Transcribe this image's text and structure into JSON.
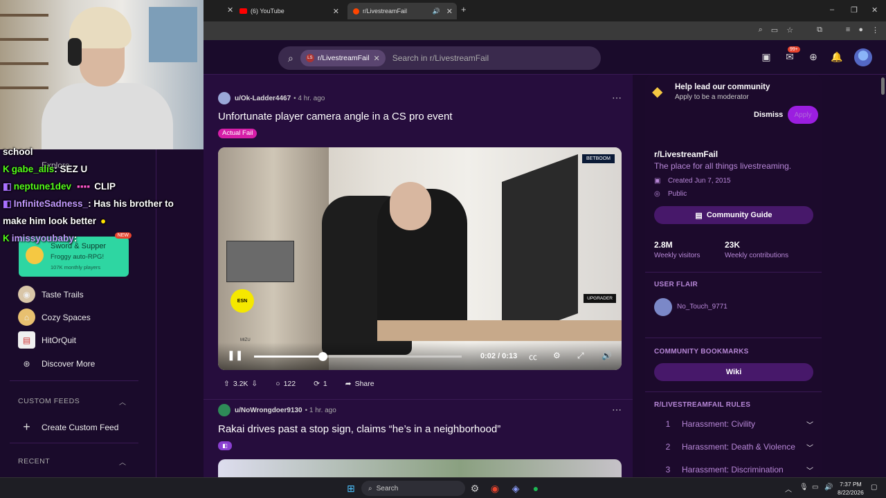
{
  "browser": {
    "tabs": [
      {
        "label": "(6) YouTube",
        "color": "#ff0000"
      },
      {
        "label": "r/LivestreamFail",
        "color": "#ff4500"
      }
    ],
    "new_tab": "+",
    "window_controls": [
      "–",
      "❐",
      "✕"
    ]
  },
  "reddit_header": {
    "search_chip": "r/LivestreamFail",
    "search_placeholder": "Search in r/LivestreamFail",
    "notification_count": "99+"
  },
  "chat": [
    {
      "platform": "",
      "user": "school",
      "message": ""
    },
    {
      "platform": "kick",
      "user": "gabe_alis",
      "message": ": SEZ U"
    },
    {
      "platform": "twitch",
      "user": "neptune1dev",
      "message": "CLIP"
    },
    {
      "platform": "twitch",
      "user": "InfiniteSadness_",
      "message": ": Has his brother to"
    },
    {
      "platform": "",
      "user": "",
      "message": "make him look better"
    },
    {
      "platform": "kick",
      "user": "imissyoubaby",
      "message": ":"
    }
  ],
  "left_sidebar": {
    "explore": "Explore",
    "promo": {
      "title": "Sword & Supper",
      "subtitle": "Froggy auto-RPG!",
      "meta": "107K monthly players",
      "badge": "NEW"
    },
    "items": [
      {
        "label": "Taste Trails",
        "icon": "taste-trails-icon"
      },
      {
        "label": "Cozy Spaces",
        "icon": "cozy-spaces-icon"
      },
      {
        "label": "HitOrQuit",
        "icon": "hitorquit-icon"
      },
      {
        "label": "Discover More",
        "icon": "gamepad-icon"
      }
    ],
    "custom_feeds_header": "CUSTOM FEEDS",
    "create_custom_feed": "Create Custom Feed",
    "recent_header": "RECENT"
  },
  "posts": [
    {
      "user": "u/Ok-Ladder4467",
      "time": "• 4 hr. ago",
      "title": "Unfortunate player camera angle in a CS pro event",
      "flair": "Actual Fail",
      "video": {
        "time": "0:02 / 0:13",
        "progress": 0.15,
        "sponsor_top": "BETBOOM",
        "sponsor_bottom": "UPGRADER",
        "watermark": "MIZU",
        "logo": "ESN"
      },
      "upvotes": "3.2K",
      "comments": "122",
      "crossposts": "1",
      "share": "Share"
    },
    {
      "user": "u/NoWrongdoer9130",
      "time": "• 1 hr. ago",
      "title": "Rakai drives past a stop sign, claims “he’s in a neighborhood”"
    }
  ],
  "right_sidebar": {
    "mod_title": "Help lead our community",
    "mod_subtitle": "Apply to be a moderator",
    "dismiss": "Dismiss",
    "apply": "Apply",
    "community_name": "r/LivestreamFail",
    "community_desc": "The place for all things livestreaming.",
    "created": "Created Jun 7, 2015",
    "visibility": "Public",
    "guide_button": "Community Guide",
    "visitors_value": "2.8M",
    "visitors_label": "Weekly visitors",
    "contributions_value": "23K",
    "contributions_label": "Weekly contributions",
    "user_flair_header": "USER FLAIR",
    "user_flair_name": "No_Touch_9771",
    "bookmarks_header": "COMMUNITY BOOKMARKS",
    "wiki": "Wiki",
    "rules_header": "R/LIVESTREAMFAIL RULES",
    "rules": [
      {
        "num": "1",
        "label": "Harassment: Civility"
      },
      {
        "num": "2",
        "label": "Harassment: Death & Violence"
      },
      {
        "num": "3",
        "label": "Harassment: Discrimination"
      }
    ]
  },
  "taskbar": {
    "search": "Search",
    "time": "7:37 PM",
    "date": "8/22/2026"
  }
}
